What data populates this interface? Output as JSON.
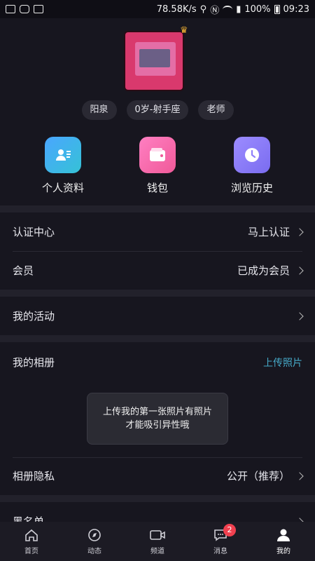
{
  "status_bar": {
    "speed": "78.58K/s",
    "battery": "100%",
    "time": "09:23"
  },
  "profile": {
    "tags": [
      "阳泉",
      "0岁-射手座",
      "老师"
    ]
  },
  "shortcuts": [
    {
      "label": "个人资料",
      "icon": "profile-card-icon",
      "color": "#4aa6ff"
    },
    {
      "label": "钱包",
      "icon": "wallet-icon",
      "color": "#f05a99"
    },
    {
      "label": "浏览历史",
      "icon": "clock-icon",
      "color": "#8f7ffa"
    }
  ],
  "rows": {
    "cert": {
      "label": "认证中心",
      "value": "马上认证"
    },
    "vip": {
      "label": "会员",
      "value": "已成为会员"
    },
    "activity": {
      "label": "我的活动"
    },
    "album": {
      "label": "我的相册",
      "action": "上传照片"
    },
    "album_privacy": {
      "label": "相册隐私",
      "value": "公开（推荐）"
    },
    "blacklist": {
      "label": "黑名单"
    }
  },
  "toast": {
    "line1": "上传我的第一张照片有照片",
    "line2": "才能吸引异性哦"
  },
  "tabbar": {
    "items": [
      {
        "label": "首页",
        "icon": "home-icon"
      },
      {
        "label": "动态",
        "icon": "compass-icon"
      },
      {
        "label": "频道",
        "icon": "video-icon"
      },
      {
        "label": "消息",
        "icon": "message-icon",
        "badge": "2"
      },
      {
        "label": "我的",
        "icon": "user-icon"
      }
    ]
  },
  "colors": {
    "background": "#17161f",
    "accent_link": "#46a9c8",
    "badge": "#f0404f"
  }
}
